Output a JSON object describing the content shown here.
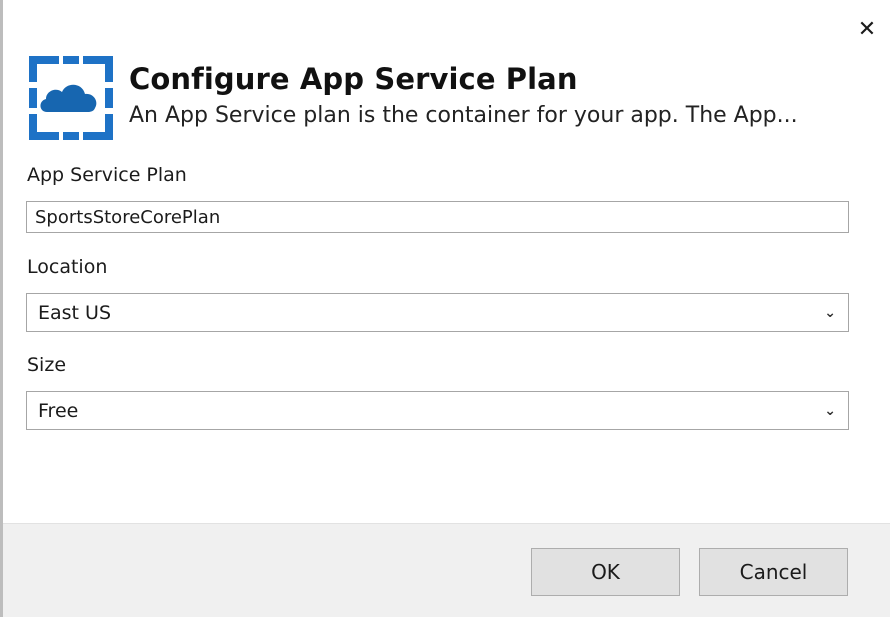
{
  "dialog": {
    "close_glyph": "✕",
    "title": "Configure App Service Plan",
    "subtitle": "An App Service plan is the container for your app. The App...",
    "logo_icon": "azure-app-service-icon"
  },
  "fields": {
    "plan": {
      "label": "App Service Plan",
      "value": "SportsStoreCorePlan"
    },
    "location": {
      "label": "Location",
      "value": "East US"
    },
    "size": {
      "label": "Size",
      "value": "Free"
    }
  },
  "buttons": {
    "ok_label": "OK",
    "cancel_label": "Cancel"
  },
  "colors": {
    "logo_blue": "#1e72c6",
    "logo_dark": "#1766b0",
    "footer_bg": "#f0f0f0"
  }
}
